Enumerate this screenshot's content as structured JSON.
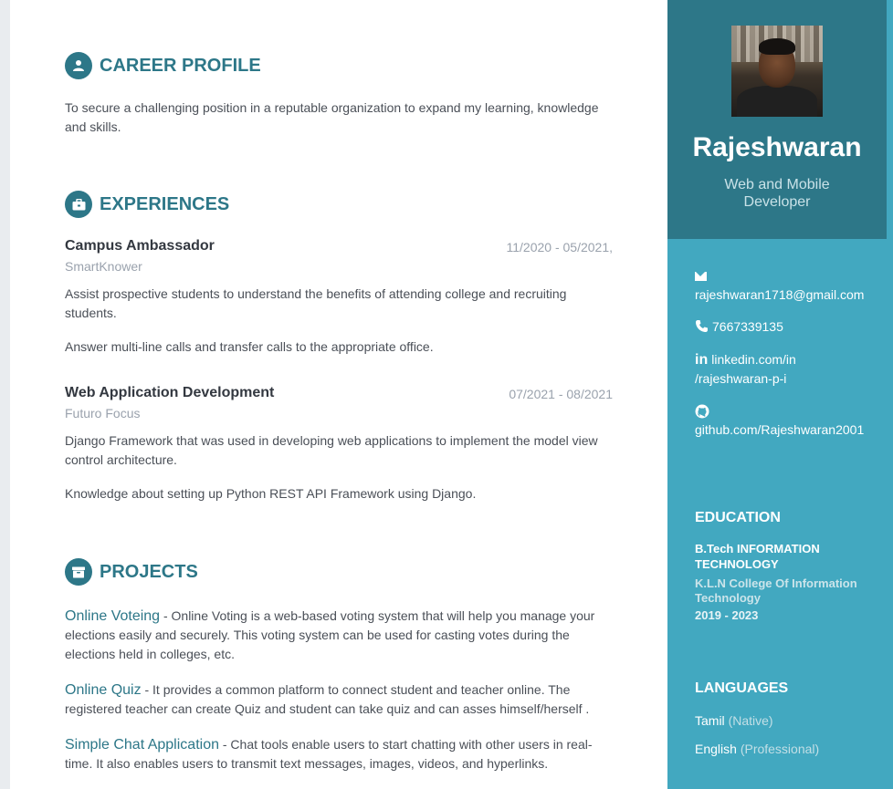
{
  "career": {
    "title": "CAREER PROFILE",
    "text": "To secure a challenging position in a reputable organization to expand my learning, knowledge and skills."
  },
  "experiences": {
    "title": "EXPERIENCES",
    "items": [
      {
        "role": "Campus Ambassador",
        "date": "11/2020 - 05/2021,",
        "company": "SmartKnower",
        "details": [
          "Assist prospective students to understand the benefits of attending college and recruiting students.",
          "Answer multi-line calls and transfer calls to the appropriate office."
        ]
      },
      {
        "role": "Web Application Development",
        "date": "07/2021 - 08/2021",
        "company": "Futuro Focus",
        "details": [
          "Django Framework that was used in developing web applications to implement the model view control architecture.",
          "Knowledge about setting up Python REST API Framework using Django."
        ]
      }
    ]
  },
  "projects": {
    "title": "PROJECTS",
    "items": [
      {
        "name": "Online Voteing",
        "desc": " - Online Voting is a web-based voting system that will help you manage your elections easily and securely. This voting system can be used for casting votes during the elections held in colleges, etc."
      },
      {
        "name": "Online Quiz",
        "desc": " - It provides a common platform to connect student and teacher online. The registered teacher can create Quiz and student can take quiz and can asses himself/herself ."
      },
      {
        "name": "Simple Chat Application",
        "desc": " - Chat tools enable users to start chatting with other users in real-time. It also enables users to transmit text messages, images, videos, and hyperlinks."
      }
    ]
  },
  "sidebar": {
    "name": "Rajeshwaran",
    "tagline": "Web and Mobile Developer",
    "email": "rajeshwaran1718@gmail.com",
    "phone": "7667339135",
    "linkedin_1": "linkedin.com/in",
    "linkedin_2": "/rajeshwaran-p-i",
    "github": "github.com/Rajeshwaran2001",
    "education": {
      "title": "EDUCATION",
      "degree": "B.Tech INFORMATION TECHNOLOGY",
      "college": "K.L.N College Of Information Technology",
      "years": "2019 - 2023"
    },
    "languages": {
      "title": "LANGUAGES",
      "items": [
        {
          "name": "Tamil",
          "level": "(Native)"
        },
        {
          "name": "English",
          "level": "(Professional)"
        }
      ]
    }
  },
  "colors": {
    "accent": "#2d7788",
    "sidebar": "#42a8c0"
  }
}
